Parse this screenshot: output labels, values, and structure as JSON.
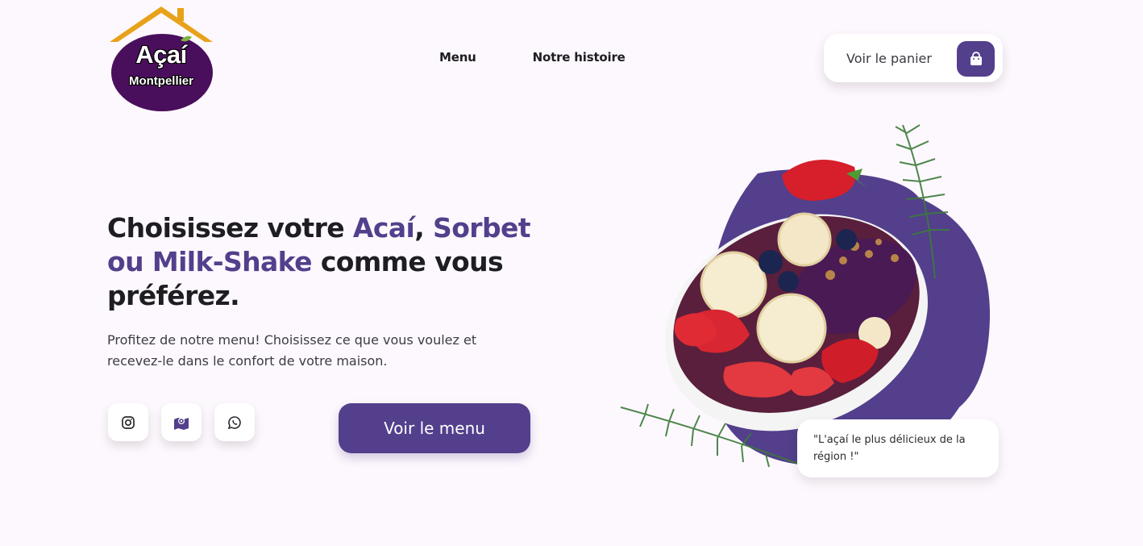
{
  "brand": {
    "line1": "Açaí",
    "line2": "Montpellier",
    "colors": {
      "primary": "#533f8c",
      "logo_bg": "#4a0f5c",
      "roof": "#e8a21a",
      "leaf": "#7cb342"
    }
  },
  "nav": {
    "items": [
      {
        "label": "Menu"
      },
      {
        "label": "Notre histoire"
      }
    ]
  },
  "cart": {
    "label": "Voir le panier",
    "icon": "shopping-bag-icon"
  },
  "hero": {
    "title_part1": "Choisissez votre ",
    "title_accent1": "Acaí",
    "title_sep": ", ",
    "title_accent2": "Sorbet ou Milk-Shake",
    "title_part2": " comme vous préférez.",
    "subtitle": "Profitez de notre menu! Choisissez ce que vous voulez et recevez-le dans le confort de votre maison.",
    "cta_label": "Voir le menu"
  },
  "socials": [
    {
      "icon": "instagram-icon"
    },
    {
      "icon": "map-icon"
    },
    {
      "icon": "whatsapp-icon"
    }
  ],
  "quote": {
    "text": "\"L'açaí le plus délicieux de la région !\""
  }
}
